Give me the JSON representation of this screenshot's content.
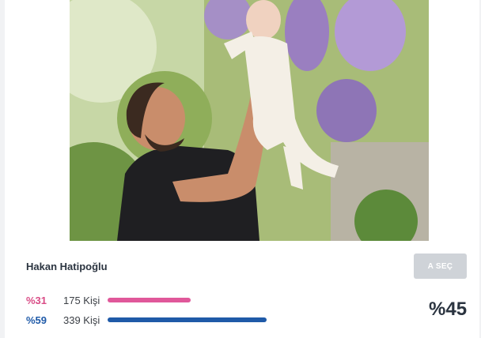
{
  "option": {
    "name": "Hakan Hatipoğlu",
    "select_label": "A SEÇ",
    "total_percent": "%45"
  },
  "stats": [
    {
      "percent_label": "%31",
      "count_label": "175 Kişi",
      "fraction": 0.31,
      "color": "#e0589a"
    },
    {
      "percent_label": "%59",
      "count_label": "339 Kişi",
      "fraction": 0.59,
      "color": "#1f5aa8"
    }
  ]
}
